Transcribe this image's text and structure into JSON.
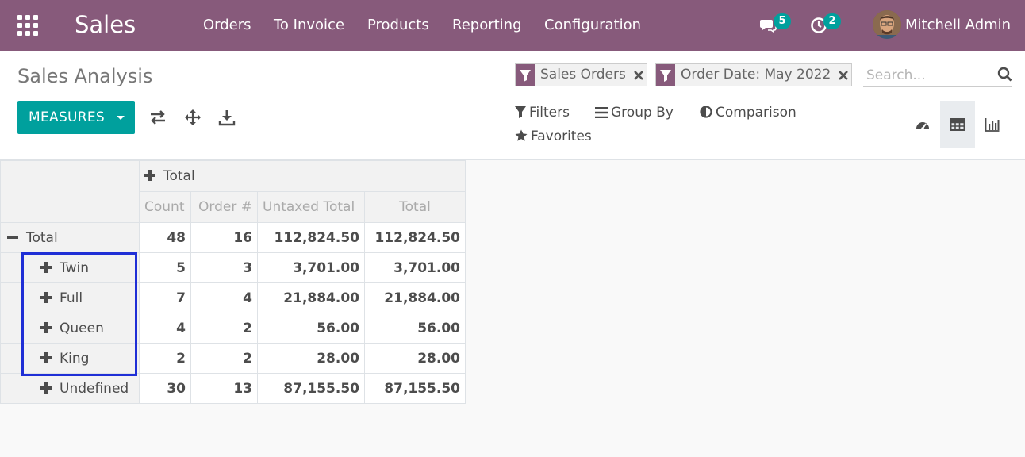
{
  "navbar": {
    "app_name": "Sales",
    "menu": [
      "Orders",
      "To Invoice",
      "Products",
      "Reporting",
      "Configuration"
    ],
    "messages_badge": "5",
    "activities_badge": "2",
    "user_name": "Mitchell Admin",
    "colors": {
      "navbar_bg": "#875a7b",
      "badge_bg": "#00a09d"
    }
  },
  "control_panel": {
    "title": "Sales Analysis",
    "measures_label": "MEASURES",
    "facets": [
      "Sales Orders",
      "Order Date: May 2022"
    ],
    "search_placeholder": "Search...",
    "filters_label": "Filters",
    "groupby_label": "Group By",
    "comparison_label": "Comparison",
    "favorites_label": "Favorites",
    "active_view": "pivot",
    "colors": {
      "primary_button": "#00a09d"
    }
  },
  "pivot": {
    "col_header": "Total",
    "measures": [
      "Count",
      "Order #",
      "Untaxed Total",
      "Total"
    ],
    "rows": [
      {
        "label": "Total",
        "expanded": true,
        "values": [
          "48",
          "16",
          "112,824.50",
          "112,824.50"
        ]
      },
      {
        "label": "Twin",
        "expanded": false,
        "values": [
          "5",
          "3",
          "3,701.00",
          "3,701.00"
        ]
      },
      {
        "label": "Full",
        "expanded": false,
        "values": [
          "7",
          "4",
          "21,884.00",
          "21,884.00"
        ]
      },
      {
        "label": "Queen",
        "expanded": false,
        "values": [
          "4",
          "2",
          "56.00",
          "56.00"
        ]
      },
      {
        "label": "King",
        "expanded": false,
        "values": [
          "2",
          "2",
          "28.00",
          "28.00"
        ]
      },
      {
        "label": "Undefined",
        "expanded": false,
        "values": [
          "30",
          "13",
          "87,155.50",
          "87,155.50"
        ]
      }
    ],
    "highlight_color": "#1f2fd6"
  }
}
